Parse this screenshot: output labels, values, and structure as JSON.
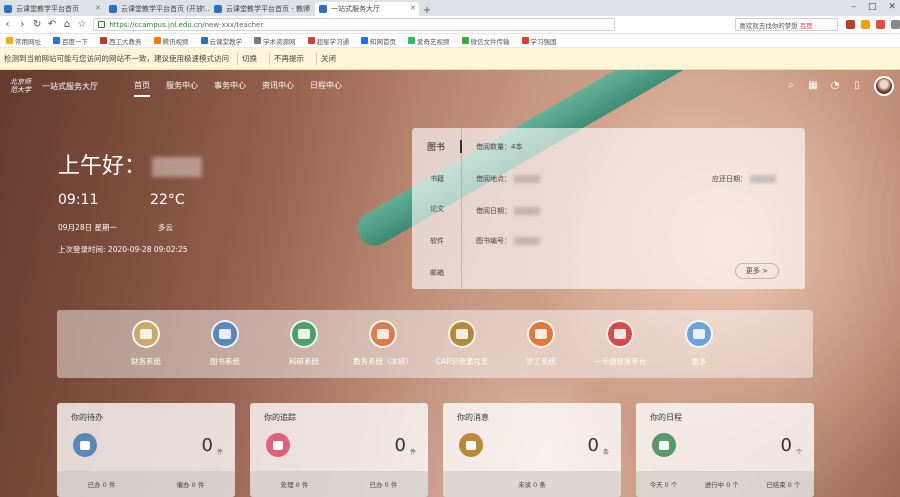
{
  "browser": {
    "tabs": [
      {
        "label": "云课堂教学平台首页",
        "active": false
      },
      {
        "label": "云课堂教学平台首页 (开放...",
        "active": false
      },
      {
        "label": "云课堂教学平台首页 - 教师",
        "active": false
      },
      {
        "label": "一站式服务大厅",
        "active": true
      }
    ],
    "new_tab": "+",
    "window_controls": [
      "–",
      "□",
      "✕"
    ],
    "address": {
      "scheme": "https://",
      "host": "ccampus.jnl.edu.cn",
      "path": "/new-xxx/teacher"
    },
    "search_text": "喜欢就去找你的梦想",
    "search_hot": "百度",
    "bookmarks": [
      {
        "label": "常用网址",
        "color": "#f0b400"
      },
      {
        "label": "百度一下",
        "color": "#2d6fd2"
      },
      {
        "label": "西工大教务",
        "color": "#c0392b"
      },
      {
        "label": "腾讯视频",
        "color": "#ff7a00"
      },
      {
        "label": "云课堂教学",
        "color": "#2e6fbf"
      },
      {
        "label": "学术资源网",
        "color": "#7a7a7a"
      },
      {
        "label": "超星学习通",
        "color": "#d43c3c"
      },
      {
        "label": "知网首页",
        "color": "#1a73e8"
      },
      {
        "label": "爱奇艺视频",
        "color": "#2dbe60"
      },
      {
        "label": "微信文件传输",
        "color": "#3aaa35"
      },
      {
        "label": "学习强国",
        "color": "#e53935"
      }
    ]
  },
  "infobar": {
    "message": "检测到当前网站可能与您访问的网站不一致，建议使用极速模式访问",
    "btn_switch": "切换",
    "btn_no_ask": "不再提示",
    "btn_close": "关闭"
  },
  "header": {
    "logo_text": "北京师范大学",
    "portal_title": "一站式服务大厅",
    "menu": [
      {
        "label": "首页",
        "active": true
      },
      {
        "label": "服务中心",
        "active": false
      },
      {
        "label": "事务中心",
        "active": false
      },
      {
        "label": "资讯中心",
        "active": false
      },
      {
        "label": "日程中心",
        "active": false
      }
    ]
  },
  "greeting": {
    "salutation": "上午好：",
    "time": "09:11",
    "temperature": "22°C",
    "date": "09月28日 星期一",
    "weather": "多云",
    "last_login_label": "上次登录时间:",
    "last_login_value": "2020-09-28 09:02:25"
  },
  "info_panel": {
    "tabs": [
      "图书",
      "书籍",
      "论文",
      "软件",
      "邮箱"
    ],
    "active_tab": "图书",
    "fields": {
      "borrow_count": "借阅数量：4本",
      "borrow_date": "借阅日期：",
      "return_date": "应还日期：",
      "borrow_place": "借阅地点：",
      "book_no": "图书编号："
    },
    "more": "更多 >"
  },
  "apps": [
    {
      "label": "财务系统",
      "color": "#c9a96a"
    },
    {
      "label": "图书系统",
      "color": "#5b86b8"
    },
    {
      "label": "科研系统",
      "color": "#4f9e6b"
    },
    {
      "label": "教务系统（本研）",
      "color": "#d97d4c"
    },
    {
      "label": "CARSI资源共享",
      "color": "#b28a3d"
    },
    {
      "label": "学工系统",
      "color": "#e07a3c"
    },
    {
      "label": "一卡通服务平台",
      "color": "#d24c4c"
    },
    {
      "label": "更多",
      "color": "#6fa2d8"
    }
  ],
  "cards": [
    {
      "title": "你的待办",
      "count": "0",
      "unit": "件",
      "color": "#5b86b8",
      "foot": [
        "已办 0 件",
        "催办 0 件"
      ]
    },
    {
      "title": "你的追踪",
      "count": "0",
      "unit": "件",
      "color": "#e06080",
      "foot": [
        "处理 0 件",
        "已办 0 件"
      ]
    },
    {
      "title": "你的消息",
      "count": "0",
      "unit": "条",
      "color": "#b88a3a",
      "foot": [
        "未读 0 条"
      ]
    },
    {
      "title": "你的日程",
      "count": "0",
      "unit": "个",
      "color": "#5a9a6a",
      "foot": [
        "今天 0 个",
        "进行中 0 个",
        "已结束 0 个"
      ]
    }
  ]
}
